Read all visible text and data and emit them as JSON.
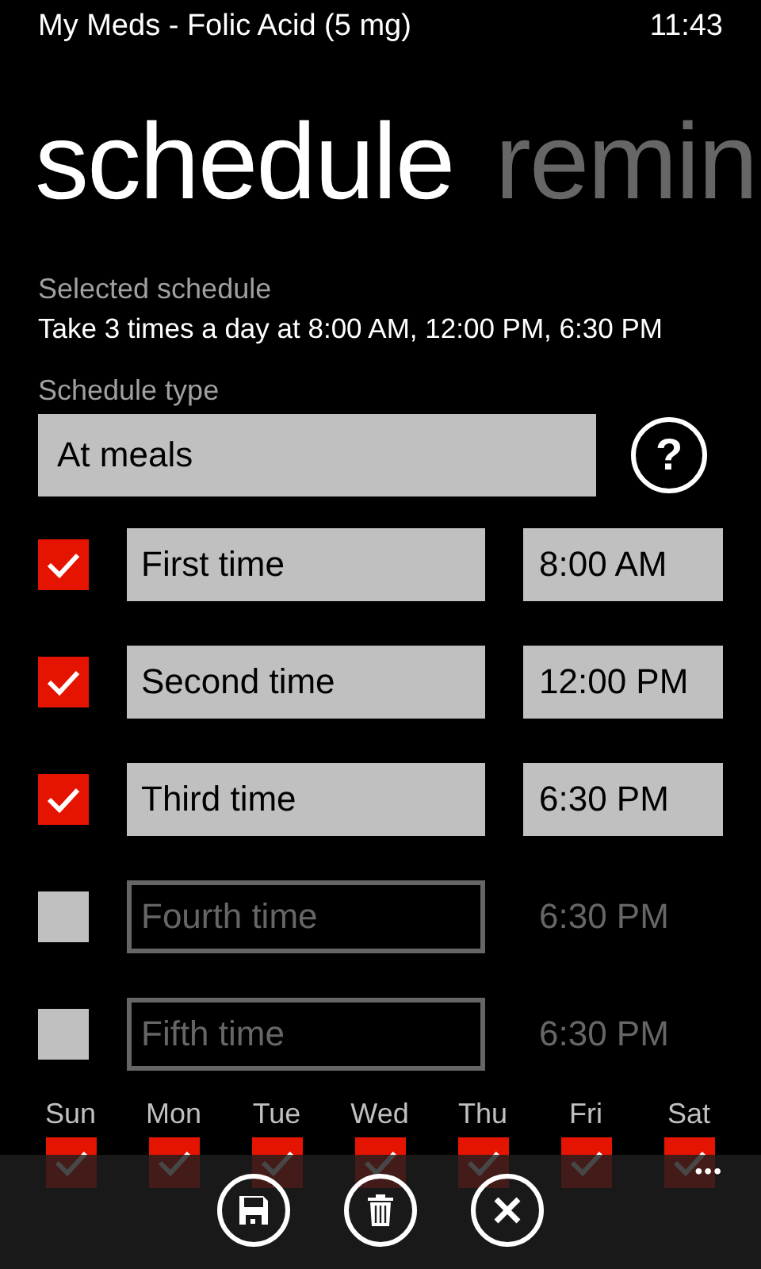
{
  "status_bar": {
    "title": "My Meds - Folic Acid (5 mg)",
    "time": "11:43"
  },
  "pivot": [
    {
      "label": "schedule",
      "selected": true
    },
    {
      "label": "remin",
      "selected": false
    }
  ],
  "selected_schedule": {
    "label": "Selected schedule",
    "value": "Take 3 times a day at 8:00 AM, 12:00 PM, 6:30 PM"
  },
  "schedule_type": {
    "label": "Schedule type",
    "value": "At meals",
    "help": "?"
  },
  "times": [
    {
      "name": "First time",
      "time": "8:00 AM",
      "checked": true
    },
    {
      "name": "Second time",
      "time": "12:00 PM",
      "checked": true
    },
    {
      "name": "Third time",
      "time": "6:30 PM",
      "checked": true
    },
    {
      "name": "Fourth time",
      "time": "6:30 PM",
      "checked": false
    },
    {
      "name": "Fifth time",
      "time": "6:30 PM",
      "checked": false
    }
  ],
  "days": [
    {
      "label": "Sun",
      "checked": true
    },
    {
      "label": "Mon",
      "checked": true
    },
    {
      "label": "Tue",
      "checked": true
    },
    {
      "label": "Wed",
      "checked": true
    },
    {
      "label": "Thu",
      "checked": true
    },
    {
      "label": "Fri",
      "checked": true
    },
    {
      "label": "Sat",
      "checked": true
    }
  ],
  "app_bar": {
    "buttons": [
      {
        "kind": "save"
      },
      {
        "kind": "delete"
      },
      {
        "kind": "cancel"
      }
    ],
    "more": "•••"
  }
}
